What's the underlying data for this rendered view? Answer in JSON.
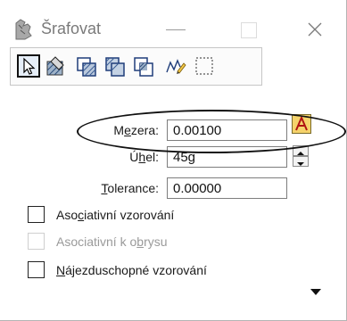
{
  "window": {
    "title": "Šrafovat"
  },
  "toolbar": {
    "tools": [
      {
        "icon": "pointer-icon"
      },
      {
        "icon": "flood-hatch-icon"
      },
      {
        "icon": "element-hatch-icon"
      },
      {
        "icon": "union-hatch-icon"
      },
      {
        "icon": "intersection-hatch-icon"
      },
      {
        "icon": "difference-hatch-icon"
      },
      {
        "icon": "fence-dashed-icon"
      }
    ]
  },
  "form": {
    "spacing": {
      "label": "Mezera:",
      "value": "0.00100"
    },
    "angle": {
      "label": "Úhel:",
      "value": "45g"
    },
    "tolerance": {
      "label": "Tolerance:",
      "value": "0.00000"
    }
  },
  "options": {
    "associative_pattern": "Asociativní vzorování",
    "associative_boundary": "Asociativní k obrysu",
    "snappable_pattern": "Nájezduschopné vzorování"
  }
}
